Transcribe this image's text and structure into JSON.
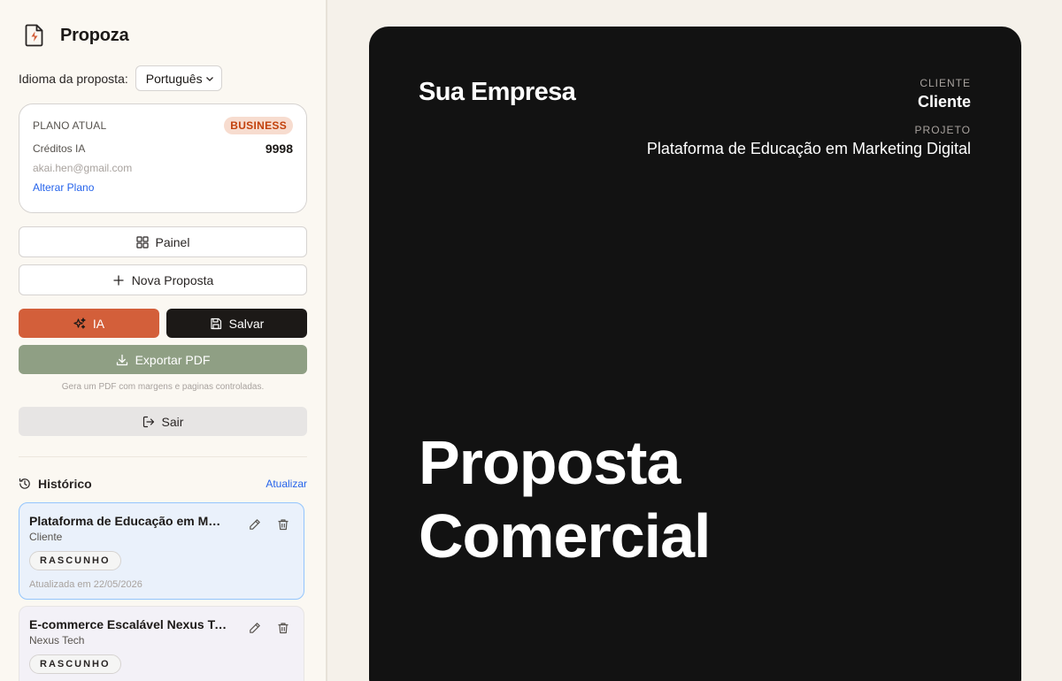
{
  "app": {
    "name": "Propoza",
    "icon": "file-bolt-icon"
  },
  "language": {
    "label": "Idioma da proposta:",
    "selected": "Português"
  },
  "plan": {
    "label": "PLANO ATUAL",
    "badge": "BUSINESS",
    "credits_label": "Créditos IA",
    "credits_value": "9998",
    "email": "akai.hen@gmail.com",
    "change_label": "Alterar Plano"
  },
  "buttons": {
    "panel": "Painel",
    "new_proposal": "Nova Proposta",
    "ai": "IA",
    "save": "Salvar",
    "export_pdf": "Exportar PDF",
    "pdf_note": "Gera um PDF com margens e paginas controladas.",
    "exit": "Sair"
  },
  "history": {
    "title": "Histórico",
    "refresh": "Atualizar",
    "items": [
      {
        "name": "Plataforma de Educação em Marketing Digital",
        "client": "Cliente",
        "status": "RASCUNHO",
        "updated": "Atualizada em 22/05/2026"
      },
      {
        "name": "E-commerce Escalável Nexus Tech",
        "client": "Nexus Tech",
        "status": "RASCUNHO"
      }
    ]
  },
  "preview": {
    "company": "Sua Empresa",
    "client_label": "CLIENTE",
    "client_value": "Cliente",
    "project_label": "PROJETO",
    "project_value": "Plataforma de Educação em Marketing Digital",
    "headline_line1": "Proposta",
    "headline_line2": "Comercial"
  },
  "colors": {
    "accent": "#d35f3a",
    "dark": "#1c1917",
    "sage": "#8f9f84",
    "link": "#2563eb",
    "preview_bg": "#121212"
  }
}
